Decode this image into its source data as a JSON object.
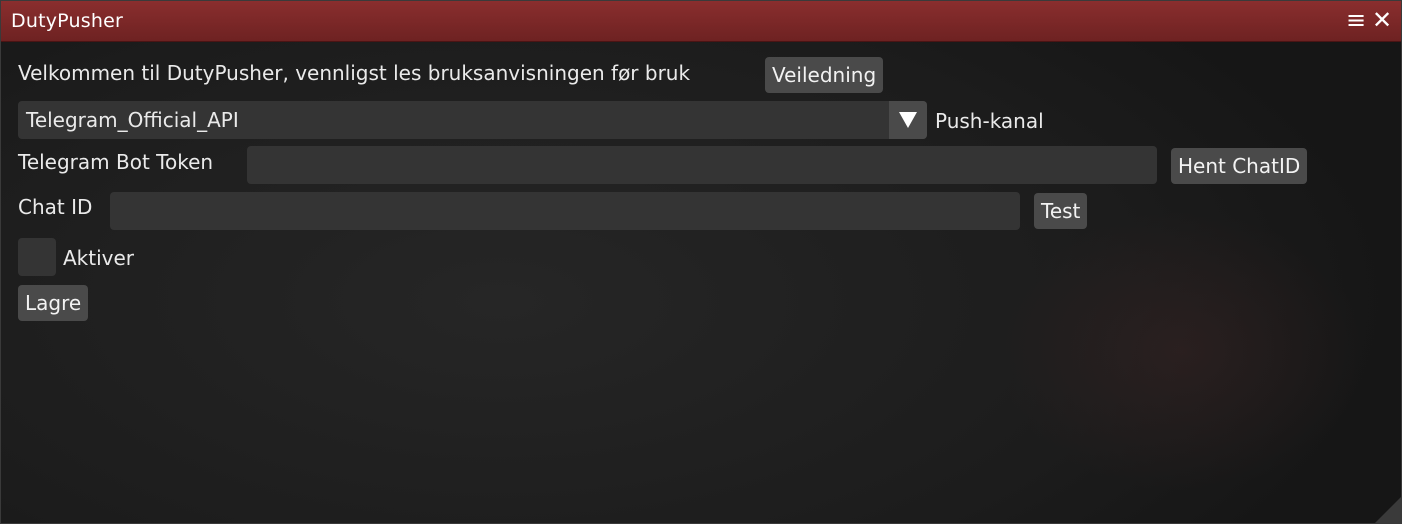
{
  "window": {
    "title": "DutyPusher",
    "menu_icon": "hamburger-menu-icon",
    "close_icon": "close-icon"
  },
  "intro": {
    "text": "Velkommen til DutyPusher, vennligst les bruksanvisningen før bruk",
    "guide_button": "Veiledning"
  },
  "channel": {
    "selected": "Telegram_Official_API",
    "label": "Push-kanal"
  },
  "token": {
    "label": "Telegram Bot Token",
    "value": "",
    "button": "Hent ChatID"
  },
  "chat": {
    "label": "Chat ID",
    "value": "",
    "button": "Test"
  },
  "enable": {
    "label": "Aktiver",
    "checked": false
  },
  "save_button": "Lagre",
  "colors": {
    "titlebar": "#7a2828",
    "background": "#1e1e1e",
    "control": "#343434",
    "button": "#4a4a4a",
    "text": "#eaeaea"
  }
}
